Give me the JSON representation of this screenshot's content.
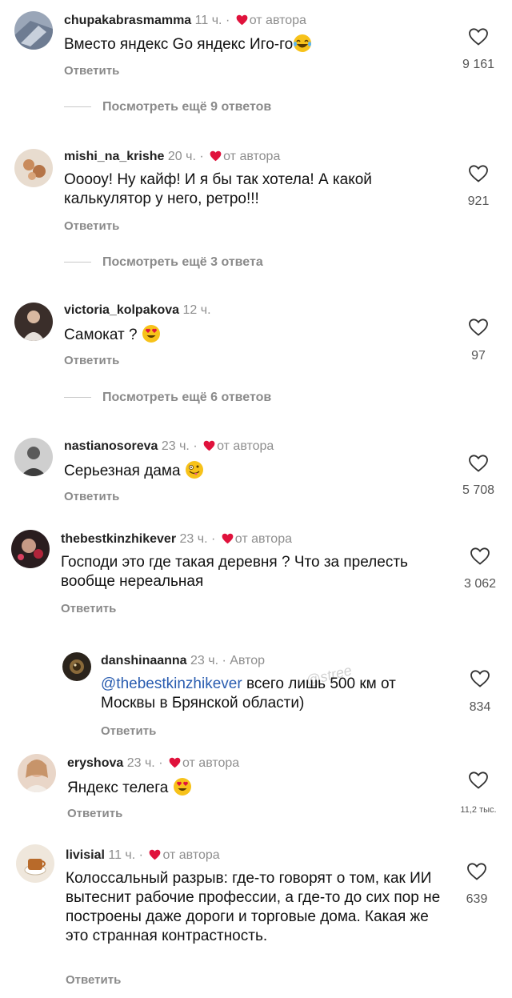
{
  "labels": {
    "reply": "Ответить",
    "author_badge": "от автора",
    "author_word": "Автор",
    "separator": "·"
  },
  "colors": {
    "heart": "#e0123c",
    "mention": "#2a5db0",
    "secondary": "#8e8e8e"
  },
  "comments": [
    {
      "user": "chupakabrasmamma",
      "time": "11 ч.",
      "text": "Вместо яндекс Go яндекс Иго-го",
      "emoji": "laughing-emoji",
      "likes": "9 161",
      "more": "Посмотреть ещё 9 ответов"
    },
    {
      "user": "mishi_na_krishe",
      "time": "20 ч.",
      "text": "Ооооу! Ну кайф! И я бы так хотела! А какой калькулятор у него, ретро!!!",
      "likes": "921",
      "more": "Посмотреть ещё 3 ответа"
    },
    {
      "user": "victoria_kolpakova",
      "time": "12 ч.",
      "text": "Самокат ?",
      "emoji": "heart-eyes-emoji",
      "likes": "97",
      "more": "Посмотреть ещё 6 ответов"
    },
    {
      "user": "nastianosoreva",
      "time": "23 ч.",
      "text": "Серьезная дама",
      "emoji": "zany-face-emoji",
      "likes": "5 708"
    },
    {
      "user": "thebestkinzhikever",
      "time": "23 ч.",
      "text": "Господи это где такая деревня ? Что за прелесть вообще нереальная",
      "likes": "3 062"
    },
    {
      "user": "danshinaanna",
      "time": "23 ч.",
      "mention": "@thebestkinzhikever",
      "text": "всего лишь 500 км от Москвы в Брянской области)",
      "likes": "834",
      "watermark": "@stree"
    },
    {
      "user": "eryshova",
      "time": "23 ч.",
      "text": "Яндекс телега",
      "emoji": "heart-eyes-emoji",
      "likes": "11,2 тыс."
    },
    {
      "user": "livisial",
      "time": "11 ч.",
      "text": "Колоссальный разрыв: где-то говорят о том, как ИИ вытеснит рабочие профессии, а где-то до сих пор не построены даже дороги и торговые дома. Какая же это странная контрастность.",
      "likes": "639"
    }
  ]
}
